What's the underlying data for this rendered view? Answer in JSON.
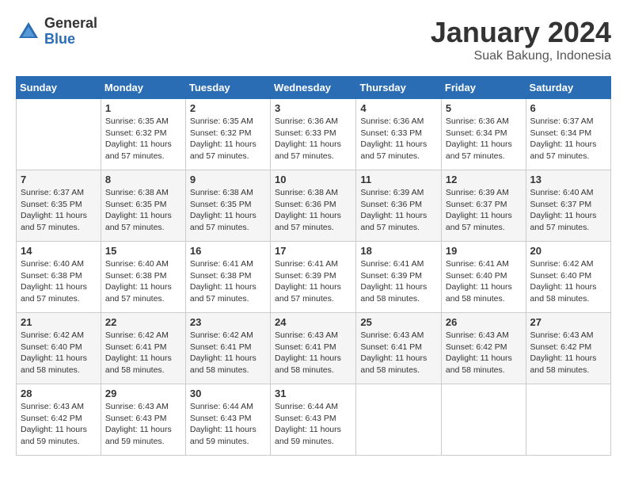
{
  "header": {
    "logo_general": "General",
    "logo_blue": "Blue",
    "month": "January 2024",
    "location": "Suak Bakung, Indonesia"
  },
  "weekdays": [
    "Sunday",
    "Monday",
    "Tuesday",
    "Wednesday",
    "Thursday",
    "Friday",
    "Saturday"
  ],
  "weeks": [
    [
      {
        "day": "",
        "sunrise": "",
        "sunset": "",
        "daylight": ""
      },
      {
        "day": "1",
        "sunrise": "Sunrise: 6:35 AM",
        "sunset": "Sunset: 6:32 PM",
        "daylight": "Daylight: 11 hours and 57 minutes."
      },
      {
        "day": "2",
        "sunrise": "Sunrise: 6:35 AM",
        "sunset": "Sunset: 6:32 PM",
        "daylight": "Daylight: 11 hours and 57 minutes."
      },
      {
        "day": "3",
        "sunrise": "Sunrise: 6:36 AM",
        "sunset": "Sunset: 6:33 PM",
        "daylight": "Daylight: 11 hours and 57 minutes."
      },
      {
        "day": "4",
        "sunrise": "Sunrise: 6:36 AM",
        "sunset": "Sunset: 6:33 PM",
        "daylight": "Daylight: 11 hours and 57 minutes."
      },
      {
        "day": "5",
        "sunrise": "Sunrise: 6:36 AM",
        "sunset": "Sunset: 6:34 PM",
        "daylight": "Daylight: 11 hours and 57 minutes."
      },
      {
        "day": "6",
        "sunrise": "Sunrise: 6:37 AM",
        "sunset": "Sunset: 6:34 PM",
        "daylight": "Daylight: 11 hours and 57 minutes."
      }
    ],
    [
      {
        "day": "7",
        "sunrise": "Sunrise: 6:37 AM",
        "sunset": "Sunset: 6:35 PM",
        "daylight": "Daylight: 11 hours and 57 minutes."
      },
      {
        "day": "8",
        "sunrise": "Sunrise: 6:38 AM",
        "sunset": "Sunset: 6:35 PM",
        "daylight": "Daylight: 11 hours and 57 minutes."
      },
      {
        "day": "9",
        "sunrise": "Sunrise: 6:38 AM",
        "sunset": "Sunset: 6:35 PM",
        "daylight": "Daylight: 11 hours and 57 minutes."
      },
      {
        "day": "10",
        "sunrise": "Sunrise: 6:38 AM",
        "sunset": "Sunset: 6:36 PM",
        "daylight": "Daylight: 11 hours and 57 minutes."
      },
      {
        "day": "11",
        "sunrise": "Sunrise: 6:39 AM",
        "sunset": "Sunset: 6:36 PM",
        "daylight": "Daylight: 11 hours and 57 minutes."
      },
      {
        "day": "12",
        "sunrise": "Sunrise: 6:39 AM",
        "sunset": "Sunset: 6:37 PM",
        "daylight": "Daylight: 11 hours and 57 minutes."
      },
      {
        "day": "13",
        "sunrise": "Sunrise: 6:40 AM",
        "sunset": "Sunset: 6:37 PM",
        "daylight": "Daylight: 11 hours and 57 minutes."
      }
    ],
    [
      {
        "day": "14",
        "sunrise": "Sunrise: 6:40 AM",
        "sunset": "Sunset: 6:38 PM",
        "daylight": "Daylight: 11 hours and 57 minutes."
      },
      {
        "day": "15",
        "sunrise": "Sunrise: 6:40 AM",
        "sunset": "Sunset: 6:38 PM",
        "daylight": "Daylight: 11 hours and 57 minutes."
      },
      {
        "day": "16",
        "sunrise": "Sunrise: 6:41 AM",
        "sunset": "Sunset: 6:38 PM",
        "daylight": "Daylight: 11 hours and 57 minutes."
      },
      {
        "day": "17",
        "sunrise": "Sunrise: 6:41 AM",
        "sunset": "Sunset: 6:39 PM",
        "daylight": "Daylight: 11 hours and 57 minutes."
      },
      {
        "day": "18",
        "sunrise": "Sunrise: 6:41 AM",
        "sunset": "Sunset: 6:39 PM",
        "daylight": "Daylight: 11 hours and 58 minutes."
      },
      {
        "day": "19",
        "sunrise": "Sunrise: 6:41 AM",
        "sunset": "Sunset: 6:40 PM",
        "daylight": "Daylight: 11 hours and 58 minutes."
      },
      {
        "day": "20",
        "sunrise": "Sunrise: 6:42 AM",
        "sunset": "Sunset: 6:40 PM",
        "daylight": "Daylight: 11 hours and 58 minutes."
      }
    ],
    [
      {
        "day": "21",
        "sunrise": "Sunrise: 6:42 AM",
        "sunset": "Sunset: 6:40 PM",
        "daylight": "Daylight: 11 hours and 58 minutes."
      },
      {
        "day": "22",
        "sunrise": "Sunrise: 6:42 AM",
        "sunset": "Sunset: 6:41 PM",
        "daylight": "Daylight: 11 hours and 58 minutes."
      },
      {
        "day": "23",
        "sunrise": "Sunrise: 6:42 AM",
        "sunset": "Sunset: 6:41 PM",
        "daylight": "Daylight: 11 hours and 58 minutes."
      },
      {
        "day": "24",
        "sunrise": "Sunrise: 6:43 AM",
        "sunset": "Sunset: 6:41 PM",
        "daylight": "Daylight: 11 hours and 58 minutes."
      },
      {
        "day": "25",
        "sunrise": "Sunrise: 6:43 AM",
        "sunset": "Sunset: 6:41 PM",
        "daylight": "Daylight: 11 hours and 58 minutes."
      },
      {
        "day": "26",
        "sunrise": "Sunrise: 6:43 AM",
        "sunset": "Sunset: 6:42 PM",
        "daylight": "Daylight: 11 hours and 58 minutes."
      },
      {
        "day": "27",
        "sunrise": "Sunrise: 6:43 AM",
        "sunset": "Sunset: 6:42 PM",
        "daylight": "Daylight: 11 hours and 58 minutes."
      }
    ],
    [
      {
        "day": "28",
        "sunrise": "Sunrise: 6:43 AM",
        "sunset": "Sunset: 6:42 PM",
        "daylight": "Daylight: 11 hours and 59 minutes."
      },
      {
        "day": "29",
        "sunrise": "Sunrise: 6:43 AM",
        "sunset": "Sunset: 6:43 PM",
        "daylight": "Daylight: 11 hours and 59 minutes."
      },
      {
        "day": "30",
        "sunrise": "Sunrise: 6:44 AM",
        "sunset": "Sunset: 6:43 PM",
        "daylight": "Daylight: 11 hours and 59 minutes."
      },
      {
        "day": "31",
        "sunrise": "Sunrise: 6:44 AM",
        "sunset": "Sunset: 6:43 PM",
        "daylight": "Daylight: 11 hours and 59 minutes."
      },
      {
        "day": "",
        "sunrise": "",
        "sunset": "",
        "daylight": ""
      },
      {
        "day": "",
        "sunrise": "",
        "sunset": "",
        "daylight": ""
      },
      {
        "day": "",
        "sunrise": "",
        "sunset": "",
        "daylight": ""
      }
    ]
  ]
}
